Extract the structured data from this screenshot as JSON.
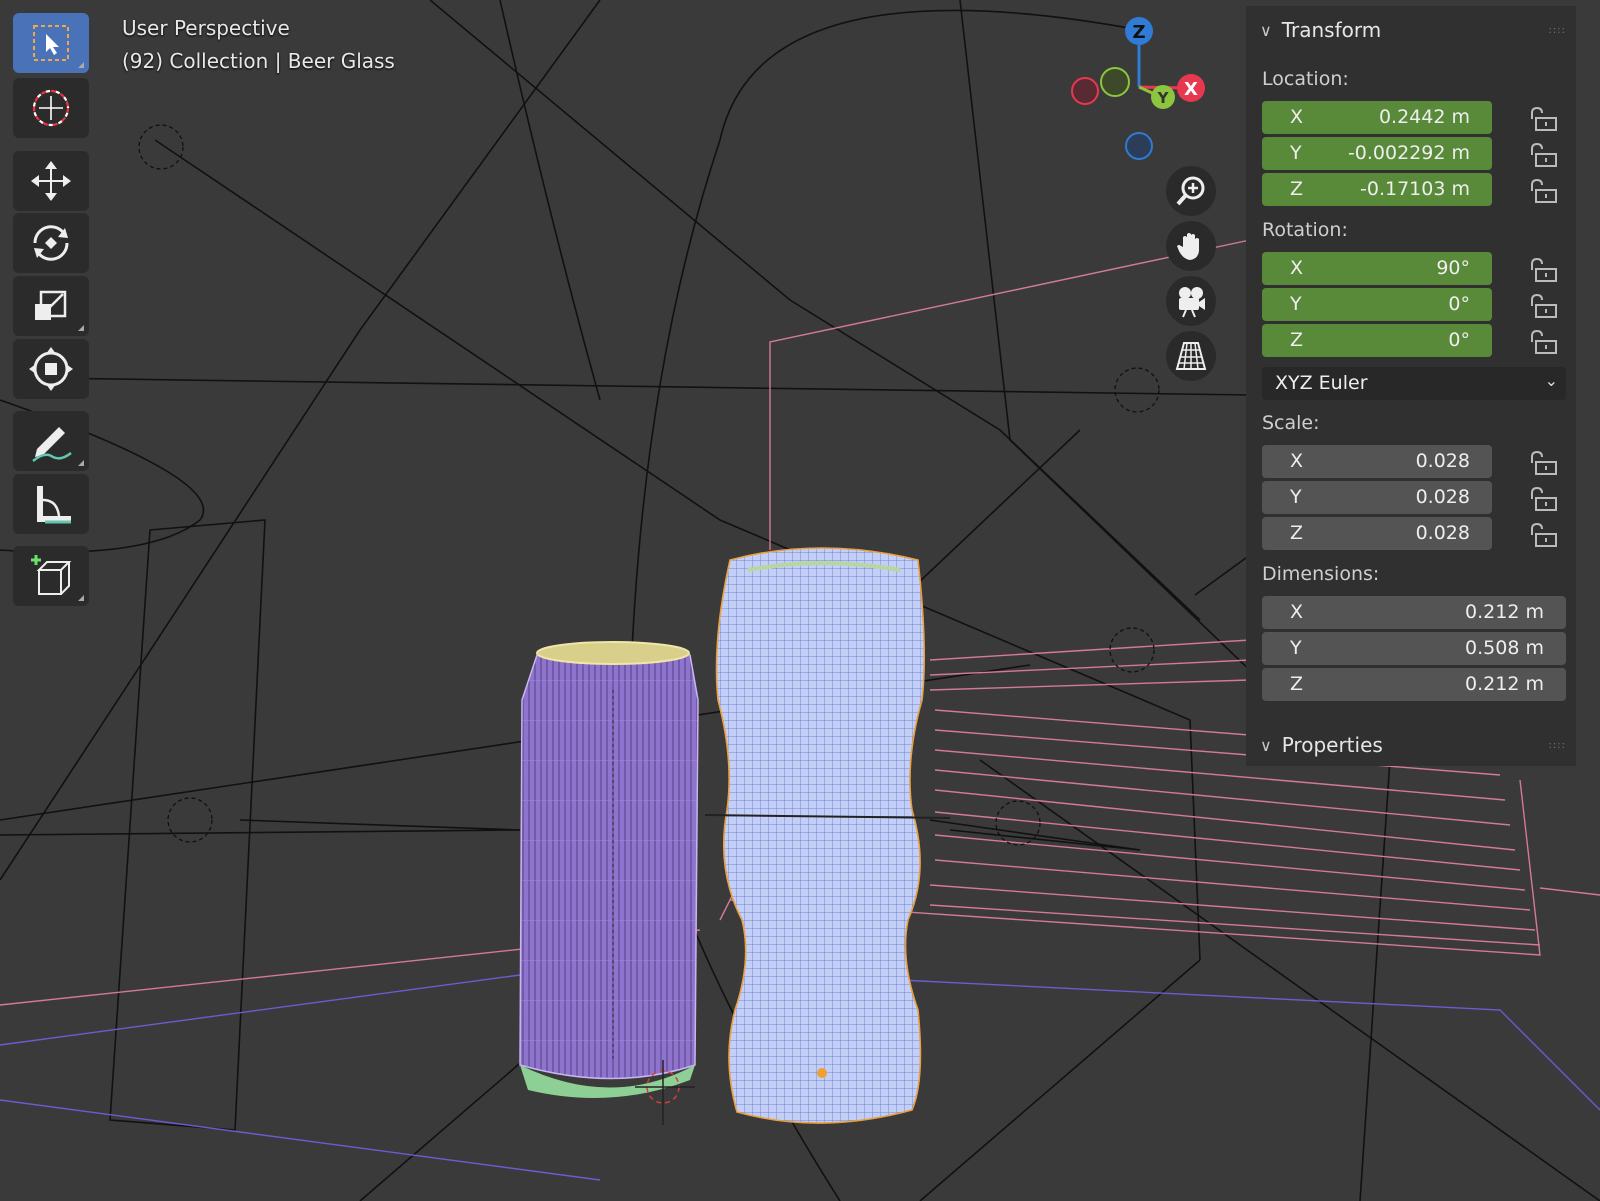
{
  "viewport": {
    "mode_label": "User Perspective",
    "object_label": "(92) Collection | Beer Glass"
  },
  "toolbar": {
    "tools": [
      "select-box",
      "cursor",
      "move",
      "rotate",
      "scale",
      "transform",
      "annotate",
      "measure",
      "add-cube"
    ],
    "active": "select-box"
  },
  "gizmo": {
    "z": "Z",
    "x": "X",
    "y": "Y",
    "colors": {
      "x": "#e8384f",
      "y": "#8cc63f",
      "z": "#2f7bd6"
    }
  },
  "nav_buttons": [
    "zoom-icon",
    "pan-hand-icon",
    "camera-icon",
    "grid-perspective-icon"
  ],
  "transform_panel": {
    "title": "Transform",
    "location_label": "Location:",
    "location": [
      {
        "axis": "X",
        "value": "0.2442 m"
      },
      {
        "axis": "Y",
        "value": "-0.002292 m"
      },
      {
        "axis": "Z",
        "value": "-0.17103 m"
      }
    ],
    "rotation_label": "Rotation:",
    "rotation": [
      {
        "axis": "X",
        "value": "90°"
      },
      {
        "axis": "Y",
        "value": "0°"
      },
      {
        "axis": "Z",
        "value": "0°"
      }
    ],
    "rotation_mode": "XYZ Euler",
    "scale_label": "Scale:",
    "scale": [
      {
        "axis": "X",
        "value": "0.028"
      },
      {
        "axis": "Y",
        "value": "0.028"
      },
      {
        "axis": "Z",
        "value": "0.028"
      }
    ],
    "dimensions_label": "Dimensions:",
    "dimensions": [
      {
        "axis": "X",
        "value": "0.212 m"
      },
      {
        "axis": "Y",
        "value": "0.508 m"
      },
      {
        "axis": "Z",
        "value": "0.212 m"
      }
    ]
  },
  "properties_panel": {
    "title": "Properties"
  },
  "colors": {
    "viewport_bg": "#3a3a3a",
    "field_green": "#598a3a",
    "field_gray": "#545454",
    "active_tool": "#4a72b8",
    "can_wire": "#9b7fd6",
    "glass_wire": "#b9c8f5"
  }
}
